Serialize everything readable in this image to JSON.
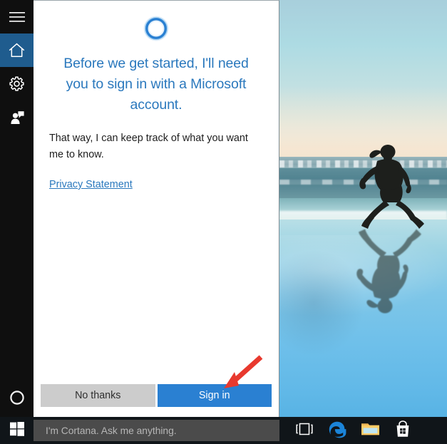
{
  "window": {
    "title": "Cortana"
  },
  "rail": {
    "items": [
      {
        "name": "hamburger-menu",
        "icon": "hamburger-icon",
        "label": "Menu",
        "selected": false
      },
      {
        "name": "home",
        "icon": "home-icon",
        "label": "Home",
        "selected": true
      },
      {
        "name": "settings",
        "icon": "gear-icon",
        "label": "Settings",
        "selected": false
      },
      {
        "name": "feedback",
        "icon": "feedback-person-icon",
        "label": "Feedback",
        "selected": false
      }
    ],
    "bottom_item": {
      "name": "cortana-circle",
      "icon": "cortana-circle-icon",
      "label": "Cortana"
    }
  },
  "main": {
    "logo_icon": "cortana-ring-icon",
    "headline": "Before we get started, I'll need you to sign in with a Microsoft account.",
    "body": "That way, I can keep track of what you want me to know.",
    "privacy_link": "Privacy Statement",
    "buttons": {
      "secondary": "No thanks",
      "primary": "Sign in"
    }
  },
  "annotation": {
    "arrow_icon": "red-arrow-icon",
    "arrow_color": "#e8392e",
    "points_at": "Sign in"
  },
  "photo": {
    "description": "Beach scene with running woman silhouette and her reflection on wet sand"
  },
  "taskbar": {
    "start": {
      "icon": "windows-logo-icon",
      "label": "Start"
    },
    "search": {
      "placeholder": "I'm Cortana. Ask me anything.",
      "value": ""
    },
    "tray_items": [
      {
        "name": "task-view",
        "icon": "task-view-icon",
        "label": "Task View"
      },
      {
        "name": "microsoft-edge",
        "icon": "edge-icon",
        "label": "Microsoft Edge"
      },
      {
        "name": "file-explorer",
        "icon": "folder-icon",
        "label": "File Explorer"
      },
      {
        "name": "microsoft-store",
        "icon": "store-bag-icon",
        "label": "Store"
      }
    ]
  },
  "colors": {
    "accent_blue": "#2a80d2",
    "headline_blue": "#2a78bd",
    "rail_background": "#0f0f0f",
    "rail_selected": "#1f5c8e",
    "secondary_button": "#cccccc",
    "taskbar": "#101519",
    "search_box": "#4b4b4b",
    "annotation_red": "#e8392e"
  }
}
